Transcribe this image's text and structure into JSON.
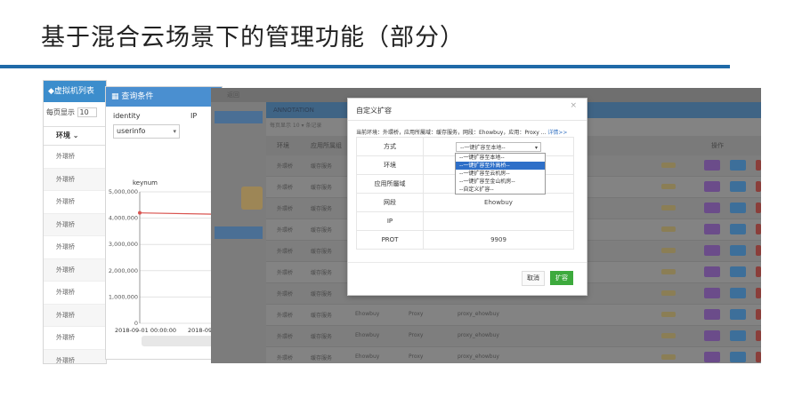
{
  "slide": {
    "title": "基于混合云场景下的管理功能（部分）"
  },
  "vm_window": {
    "title": "◆虚拟机列表",
    "page_size_label": "每页显示",
    "page_size_value": "10",
    "col_env": "环境 ⌄",
    "rows": [
      "外環桥",
      "外環桥",
      "外環桥",
      "外環桥",
      "外環桥",
      "外環桥",
      "外環桥",
      "外環桥",
      "外環桥",
      "外環桥"
    ]
  },
  "query_window": {
    "title": "查询条件",
    "identity_label": "identity",
    "ip_label": "IP",
    "identity_value": "userinfo",
    "chart_title": "keynum"
  },
  "chart_data": {
    "type": "line",
    "title": "keynum",
    "ylim": [
      0,
      5000000
    ],
    "yticks": [
      "0",
      "1,000,000",
      "2,000,000",
      "3,000,000",
      "4,000,000",
      "5,000,000"
    ],
    "x": [
      "2018-09-01 00:00:00",
      "2018-09-0"
    ],
    "series": [
      {
        "values": [
          4200000,
          4150000
        ]
      }
    ],
    "grid": true
  },
  "bg_window": {
    "title": "返回",
    "list_title": "ANNOTATION",
    "meta": "每页显示 10 ▾ 条记录",
    "col_env": "环境",
    "col_group": "应用所属组",
    "col_ops": "操作",
    "rows": [
      {
        "env": "外環桥",
        "group": "缓存服务",
        "name": "",
        "type": "",
        "key": ""
      },
      {
        "env": "外環桥",
        "group": "缓存服务",
        "name": "",
        "type": "",
        "key": ""
      },
      {
        "env": "外環桥",
        "group": "缓存服务",
        "name": "",
        "type": "",
        "key": ""
      },
      {
        "env": "外環桥",
        "group": "缓存服务",
        "name": "",
        "type": "",
        "key": ""
      },
      {
        "env": "外環桥",
        "group": "缓存服务",
        "name": "",
        "type": "",
        "key": ""
      },
      {
        "env": "外環桥",
        "group": "缓存服务",
        "name": "",
        "type": "",
        "key": ""
      },
      {
        "env": "外環桥",
        "group": "缓存服务",
        "name": "",
        "type": "",
        "key": ""
      },
      {
        "env": "外環桥",
        "group": "缓存服务",
        "name": "Ehowbuy",
        "type": "Proxy",
        "key": "proxy_ehowbuy"
      },
      {
        "env": "外環桥",
        "group": "缓存服务",
        "name": "Ehowbuy",
        "type": "Proxy",
        "key": "proxy_ehowbuy"
      },
      {
        "env": "外環桥",
        "group": "缓存服务",
        "name": "Ehowbuy",
        "type": "Proxy",
        "key": "proxy_ehowbuy"
      }
    ]
  },
  "modal": {
    "title": "自定义扩容",
    "close": "×",
    "current_env": "当前环境：外環桥，应用所屬域：缓存服务，网段：Ehowbuy，应用：Proxy ... ",
    "detail_link": "详情>>",
    "fields": {
      "mode_label": "方式",
      "env_label": "环境",
      "domain_label": "应用所屬域",
      "segment_label": "网段",
      "segment_value": "Ehowbuy",
      "ip_label": "IP",
      "ip_value": "",
      "port_label": "PROT",
      "port_value": "9909"
    },
    "mode_selected": "--一键扩容至本地--",
    "mode_options": [
      "--一键扩容至本地--",
      "--一键扩容至外高桥--",
      "--一键扩容至云机房--",
      "--一键扩容至金山机房--",
      "--自定义扩容--"
    ],
    "cancel_label": "取消",
    "ok_label": "扩容"
  },
  "colors": {
    "accent": "#1f6aa8",
    "header_blue": "#3c8dcc",
    "ok_green": "#3daa3d"
  }
}
